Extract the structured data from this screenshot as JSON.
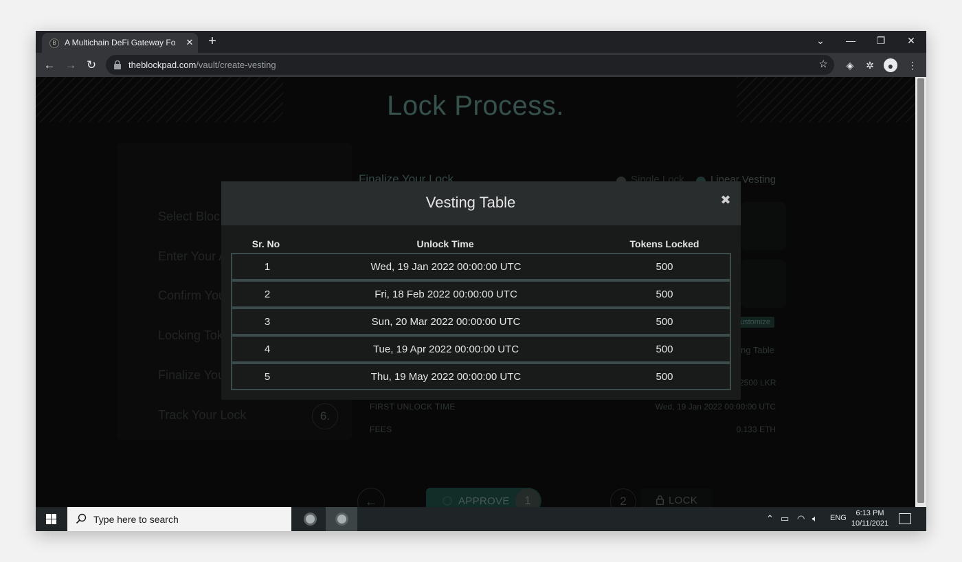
{
  "browser": {
    "tab_title": "A Multichain DeFi Gateway For Th",
    "tab_close": "✕",
    "new_tab": "+",
    "url_host": "theblockpad.com",
    "url_path": "/vault/create-vesting",
    "controls": {
      "chevron": "⌄",
      "minimize": "—",
      "restore": "❐",
      "close": "✕"
    }
  },
  "page": {
    "title": "Lock Process.",
    "steps": [
      {
        "label": "Select Bloc"
      },
      {
        "label": "Enter Your A"
      },
      {
        "label": "Confirm You"
      },
      {
        "label": "Locking Tok"
      },
      {
        "label": "Finalize You"
      },
      {
        "label": "Track Your Lock"
      }
    ],
    "step6_number": "6.",
    "finalize_title": "Finalize Your Lock",
    "lock_types": [
      {
        "label": "Single Lock",
        "selected": false
      },
      {
        "label": "Linear Vesting",
        "selected": true
      }
    ],
    "customize_label": "ustomize",
    "vesting_table_link": "ng Table",
    "total_value": "2500 LKR",
    "info": [
      {
        "label": "FIRST UNLOCK TIME",
        "value": "Wed, 19 Jan 2022 00:00:00 UTC"
      },
      {
        "label": "FEES",
        "value": "0.133 ETH"
      }
    ],
    "back_arrow": "←",
    "approve": {
      "label": "APPROVE",
      "step": "1"
    },
    "lock": {
      "label": "LOCK",
      "step": "2"
    }
  },
  "modal": {
    "title": "Vesting Table",
    "close": "✖",
    "columns": [
      "Sr. No",
      "Unlock Time",
      "Tokens Locked"
    ],
    "rows": [
      {
        "no": "1",
        "time": "Wed, 19 Jan 2022 00:00:00 UTC",
        "tokens": "500"
      },
      {
        "no": "2",
        "time": "Fri, 18 Feb 2022 00:00:00 UTC",
        "tokens": "500"
      },
      {
        "no": "3",
        "time": "Sun, 20 Mar 2022 00:00:00 UTC",
        "tokens": "500"
      },
      {
        "no": "4",
        "time": "Tue, 19 Apr 2022 00:00:00 UTC",
        "tokens": "500"
      },
      {
        "no": "5",
        "time": "Thu, 19 May 2022 00:00:00 UTC",
        "tokens": "500"
      }
    ]
  },
  "taskbar": {
    "search_placeholder": "Type here to search",
    "language": "ENG",
    "time": "6:13 PM",
    "date": "10/11/2021"
  },
  "colors": {
    "accent": "#5d8a83",
    "approve_bg": "#1f4c45",
    "modal_bg": "#191b1b",
    "table_border": "#3e4b4b"
  }
}
